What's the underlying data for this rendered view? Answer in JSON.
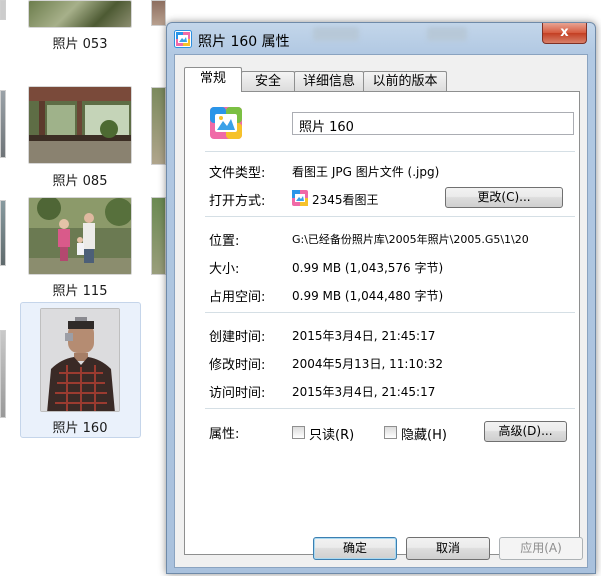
{
  "explorer": {
    "captions": [
      "照片 053",
      "照片 085",
      "照片 115",
      "照片 160"
    ]
  },
  "dialog": {
    "title": "照片 160 属性",
    "close_glyph": "x",
    "tabs": [
      {
        "label": "常规",
        "active": true
      },
      {
        "label": "安全",
        "active": false
      },
      {
        "label": "详细信息",
        "active": false
      },
      {
        "label": "以前的版本",
        "active": false
      }
    ],
    "file_name": "照片 160",
    "file_type_label": "文件类型:",
    "file_type_value": "看图王 JPG 图片文件 (.jpg)",
    "open_with_label": "打开方式:",
    "open_with_value": "2345看图王",
    "change_button": "更改(C)...",
    "location_label": "位置:",
    "location_value": "G:\\已经备份照片库\\2005年照片\\2005.G5\\1\\20",
    "size_label": "大小:",
    "size_value": "0.99 MB (1,043,576 字节)",
    "size_on_disk_label": "占用空间:",
    "size_on_disk_value": "0.99 MB (1,044,480 字节)",
    "created_label": "创建时间:",
    "created_value": "2015年3月4日, 21:45:17",
    "modified_label": "修改时间:",
    "modified_value": "2004年5月13日, 11:10:32",
    "accessed_label": "访问时间:",
    "accessed_value": "2015年3月4日, 21:45:17",
    "attributes_label": "属性:",
    "readonly_label": "只读(R)",
    "hidden_label": "隐藏(H)",
    "advanced_button": "高级(D)...",
    "ok_button": "确定",
    "cancel_button": "取消",
    "apply_button": "应用(A)"
  },
  "colors": {
    "title_bar": "#b2c9e3",
    "close_button": "#c94a2d",
    "selection": "#eaf1fb",
    "default_button_border": "#3c7fb1"
  },
  "icons": {
    "app": "kantuwang-app-icon",
    "close": "close-icon"
  }
}
